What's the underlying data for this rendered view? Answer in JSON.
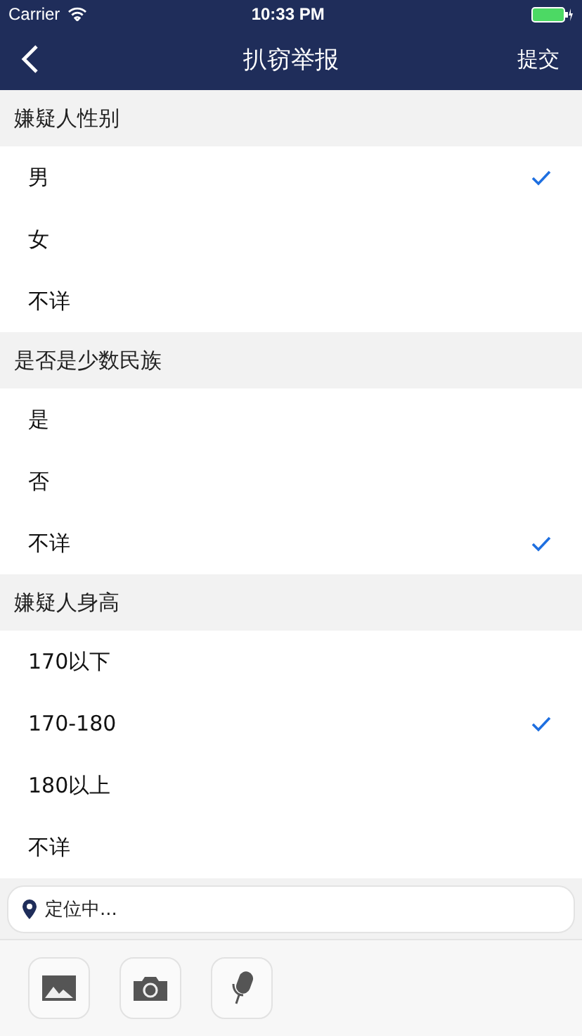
{
  "status_bar": {
    "carrier": "Carrier",
    "time": "10:33 PM"
  },
  "nav": {
    "title": "扒窃举报",
    "action": "提交"
  },
  "sections": [
    {
      "title": "嫌疑人性别",
      "options": [
        {
          "label": "男",
          "selected": true
        },
        {
          "label": "女",
          "selected": false
        },
        {
          "label": "不详",
          "selected": false
        }
      ]
    },
    {
      "title": "是否是少数民族",
      "options": [
        {
          "label": "是",
          "selected": false
        },
        {
          "label": "否",
          "selected": false
        },
        {
          "label": "不详",
          "selected": true
        }
      ]
    },
    {
      "title": "嫌疑人身高",
      "options": [
        {
          "label": "170以下",
          "selected": false
        },
        {
          "label": "170-180",
          "selected": true
        },
        {
          "label": "180以上",
          "selected": false
        },
        {
          "label": "不详",
          "selected": false
        }
      ]
    }
  ],
  "location": {
    "text": "定位中..."
  }
}
